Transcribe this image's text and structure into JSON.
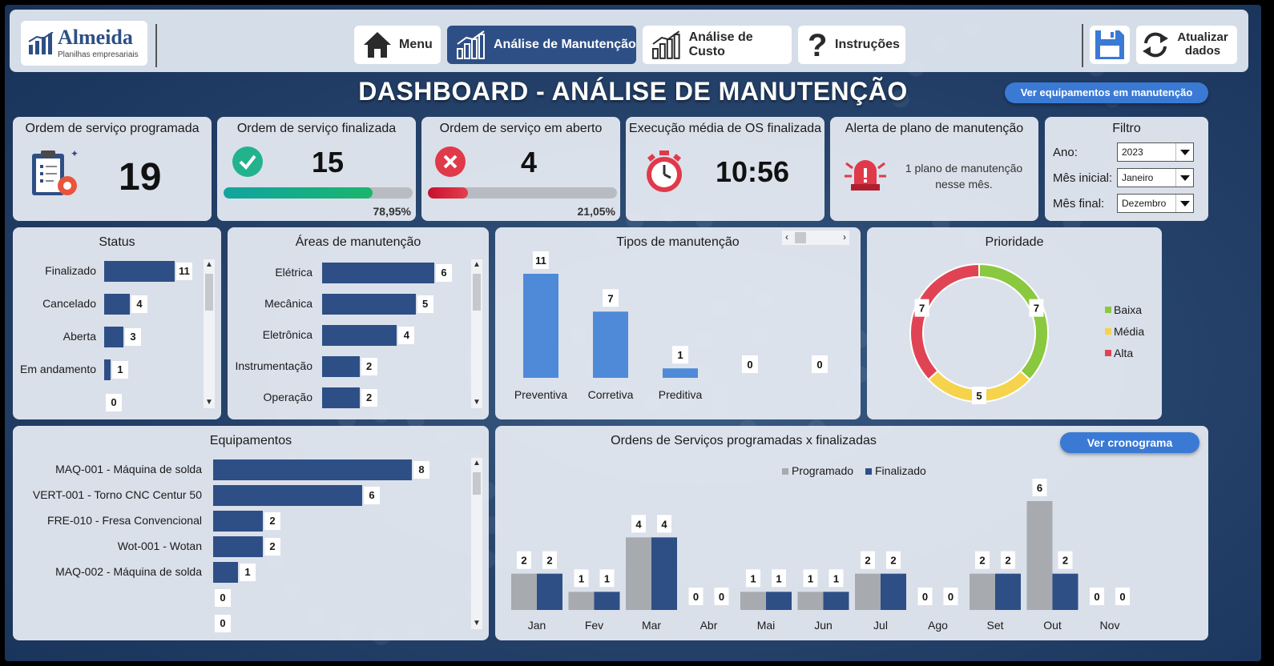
{
  "colors": {
    "navy": "#2e4f86",
    "blue": "#4f8ad8",
    "gray": "#a7aaae",
    "green": "#8ac83f",
    "yellow": "#f5d34c",
    "red": "#e04454",
    "teal": "#15b08a",
    "pill": "#3a7ad5"
  },
  "logo": {
    "name": "Almeida",
    "sub": "Planilhas empresariais",
    "icon": "bar-chart-logo-icon"
  },
  "nav": {
    "menu": {
      "label": "Menu",
      "icon": "home-icon"
    },
    "maintenance": {
      "label": "Análise de Manutenção",
      "icon": "growth-chart-icon"
    },
    "cost": {
      "label": "Análise de Custo",
      "icon": "growth-chart-icon"
    },
    "instructions": {
      "label": "Instruções",
      "icon": "question-icon"
    }
  },
  "controls": {
    "save_icon": "floppy-disk-icon",
    "refresh_label_1": "Atualizar",
    "refresh_label_2": "dados",
    "refresh_icon": "refresh-icon"
  },
  "header": {
    "title": "DASHBOARD - ANÁLISE DE MANUTENÇÃO",
    "equipment_button": "Ver equipamentos em manutenção"
  },
  "kpis": {
    "scheduled": {
      "title": "Ordem de serviço programada",
      "value": "19",
      "icon": "clipboard-icon"
    },
    "finished": {
      "title": "Ordem de serviço finalizada",
      "value": "15",
      "percent": "78,95%",
      "fraction": 0.7895,
      "icon": "check-circle-icon"
    },
    "open": {
      "title": "Ordem de serviço em aberto",
      "value": "4",
      "percent": "21,05%",
      "fraction": 0.2105,
      "icon": "x-circle-icon"
    },
    "avg_time": {
      "title": "Execução média de OS finalizada",
      "value": "10:56",
      "icon": "stopwatch-icon"
    },
    "alert": {
      "title": "Alerta de plano de manutenção",
      "text1": "1 plano de manutenção",
      "text2": "nesse mês.",
      "icon": "alert-siren-icon"
    }
  },
  "filter": {
    "title": "Filtro",
    "year_label": "Ano:",
    "year_value": "2023",
    "start_label": "Mês inicial:",
    "start_value": "Janeiro",
    "end_label": "Mês final:",
    "end_value": "Dezembro"
  },
  "status": {
    "title": "Status",
    "items": [
      {
        "label": "Finalizado",
        "value": 11
      },
      {
        "label": "Cancelado",
        "value": 4
      },
      {
        "label": "Aberta",
        "value": 3
      },
      {
        "label": "Em andamento",
        "value": 1
      },
      {
        "label": "",
        "value": 0
      }
    ]
  },
  "areas": {
    "title": "Áreas de manutenção",
    "items": [
      {
        "label": "Elétrica",
        "value": 6
      },
      {
        "label": "Mecânica",
        "value": 5
      },
      {
        "label": "Eletrônica",
        "value": 4
      },
      {
        "label": "Instrumentação",
        "value": 2
      },
      {
        "label": "Operação",
        "value": 2
      }
    ]
  },
  "types": {
    "title": "Tipos de manutenção",
    "items": [
      {
        "label": "Preventiva",
        "value": 11
      },
      {
        "label": "Corretiva",
        "value": 7
      },
      {
        "label": "Preditiva",
        "value": 1
      },
      {
        "label": "",
        "value": 0
      },
      {
        "label": "",
        "value": 0
      }
    ]
  },
  "priority": {
    "title": "Prioridade",
    "slices": [
      {
        "name": "Baixa",
        "value": 7
      },
      {
        "name": "Média",
        "value": 5
      },
      {
        "name": "Alta",
        "value": 7
      }
    ]
  },
  "equipment": {
    "title": "Equipamentos",
    "items": [
      {
        "label": "MAQ-001 - Máquina de solda",
        "value": 8
      },
      {
        "label": "VERT-001 - Torno CNC Centur 50",
        "value": 6
      },
      {
        "label": "FRE-010 - Fresa Convencional",
        "value": 2
      },
      {
        "label": "Wot-001 - Wotan",
        "value": 2
      },
      {
        "label": "MAQ-002 - Máquina de solda",
        "value": 1
      },
      {
        "label": "",
        "value": 0
      },
      {
        "label": "",
        "value": 0
      }
    ]
  },
  "orders_chart": {
    "title": "Ordens de Serviços programadas x finalizadas",
    "button": "Ver cronograma"
  },
  "chart_data": [
    {
      "type": "bar",
      "title": "Ordens de Serviços programadas x finalizadas",
      "categories": [
        "Jan",
        "Fev",
        "Mar",
        "Abr",
        "Mai",
        "Jun",
        "Jul",
        "Ago",
        "Set",
        "Out",
        "Nov"
      ],
      "series": [
        {
          "name": "Programado",
          "values": [
            2,
            1,
            4,
            0,
            1,
            1,
            2,
            0,
            2,
            6,
            0
          ]
        },
        {
          "name": "Finalizado",
          "values": [
            2,
            1,
            4,
            0,
            1,
            1,
            2,
            0,
            2,
            2,
            0
          ]
        }
      ],
      "ylim": [
        0,
        6
      ],
      "legend": "top"
    },
    {
      "type": "pie",
      "title": "Prioridade",
      "categories": [
        "Baixa",
        "Média",
        "Alta"
      ],
      "values": [
        7,
        5,
        7
      ],
      "legend": "right"
    }
  ]
}
